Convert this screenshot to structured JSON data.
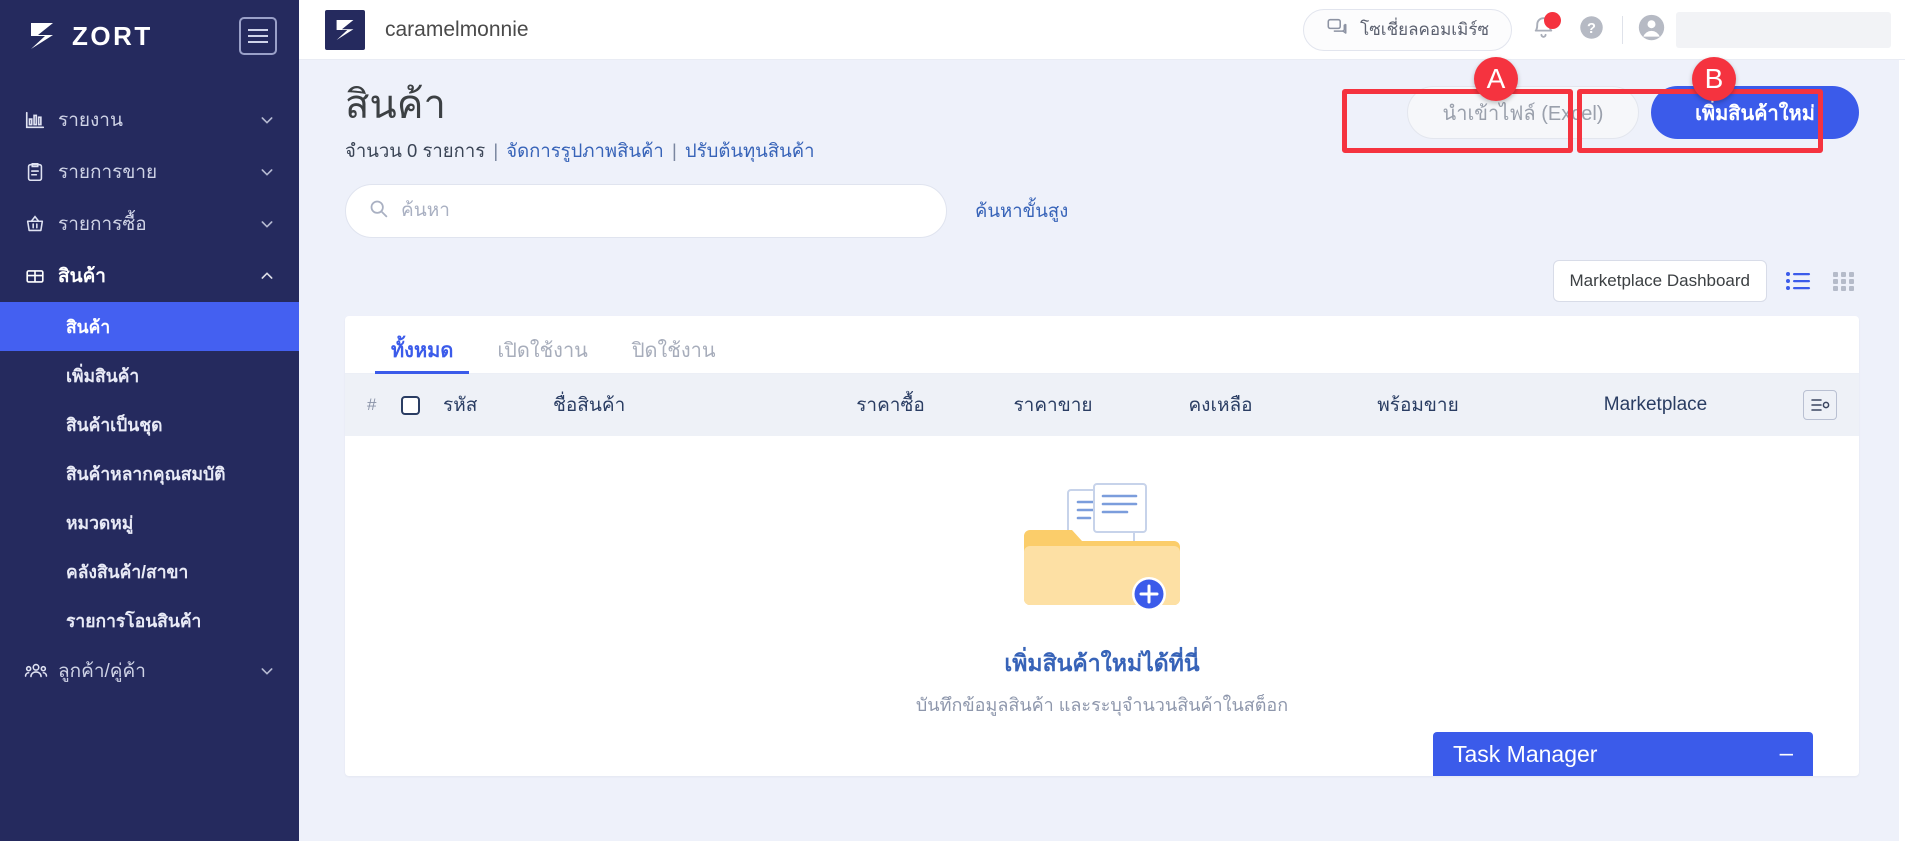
{
  "sidebar": {
    "brand": "ZORT",
    "menu_icon": "hamburger-icon",
    "items": [
      {
        "label": "รายงาน",
        "icon": "chart-bar-icon",
        "expanded": false
      },
      {
        "label": "รายการขาย",
        "icon": "clipboard-list-icon",
        "expanded": false
      },
      {
        "label": "รายการซื้อ",
        "icon": "basket-icon",
        "expanded": false
      },
      {
        "label": "สินค้า",
        "icon": "box-icon",
        "expanded": true
      },
      {
        "label": "ลูกค้า/คู่ค้า",
        "icon": "users-icon",
        "expanded": false
      }
    ],
    "sub_items": [
      {
        "label": "สินค้า",
        "active": true
      },
      {
        "label": "เพิ่มสินค้า",
        "active": false
      },
      {
        "label": "สินค้าเป็นชุด",
        "active": false
      },
      {
        "label": "สินค้าหลากคุณสมบัติ",
        "active": false
      },
      {
        "label": "หมวดหมู่",
        "active": false
      },
      {
        "label": "คลังสินค้า/สาขา",
        "active": false
      },
      {
        "label": "รายการโอนสินค้า",
        "active": false
      }
    ]
  },
  "topbar": {
    "shop_name": "caramelmonnie",
    "social_commerce_label": "โซเชี่ยลคอมเมิร์ซ",
    "social_icon": "chat-bubbles-icon",
    "bell_icon": "bell-icon",
    "bell_has_badge": true,
    "help_icon": "question-circle-icon",
    "avatar_icon": "user-circle-icon",
    "user_name_value": ""
  },
  "page": {
    "title": "สินค้า",
    "count_text": "จำนวน 0 รายการ",
    "link_manage_images": "จัดการรูปภาพสินค้า",
    "link_adjust_cost": "ปรับต้นทุนสินค้า",
    "separator": "|"
  },
  "actions": {
    "import_label": "นำเข้าไฟล์ (Excel)",
    "add_product_label": "เพิ่มสินค้าใหม่",
    "annotation_a": "A",
    "annotation_b": "B"
  },
  "search": {
    "placeholder": "ค้นหา",
    "value": "",
    "icon": "search-icon",
    "advanced_label": "ค้นหาขั้นสูง"
  },
  "toolbar": {
    "marketplace_dashboard_label": "Marketplace Dashboard",
    "list_view_icon": "list-view-icon",
    "grid_view_icon": "grid-view-icon"
  },
  "tabs": [
    {
      "label": "ทั้งหมด",
      "active": true
    },
    {
      "label": "เปิดใช้งาน",
      "active": false
    },
    {
      "label": "ปิดใช้งาน",
      "active": false
    }
  ],
  "table": {
    "columns": {
      "num": "#",
      "code": "รหัส",
      "name": "ชื่อสินค้า",
      "buy_price": "ราคาซื้อ",
      "sell_price": "ราคาขาย",
      "stock": "คงเหลือ",
      "ready": "พร้อมขาย",
      "marketplace": "Marketplace"
    },
    "select_all_checkbox": "unchecked",
    "column_settings_icon": "column-settings-icon",
    "rows": []
  },
  "empty_state": {
    "illustration": "folder-documents-plus-icon",
    "title": "เพิ่มสินค้าใหม่ได้ที่นี่",
    "subtitle": "บันทึกข้อมูลสินค้า และระบุจำนวนสินค้าในสต็อก"
  },
  "task_manager": {
    "title": "Task Manager",
    "minimize_label": "–"
  },
  "colors": {
    "sidebar_bg": "#252a5e",
    "accent_blue": "#3b5bea",
    "active_item": "#4460f1",
    "annotation_red": "#f5333f",
    "page_bg": "#eef1fa",
    "link_blue": "#3763b8"
  }
}
